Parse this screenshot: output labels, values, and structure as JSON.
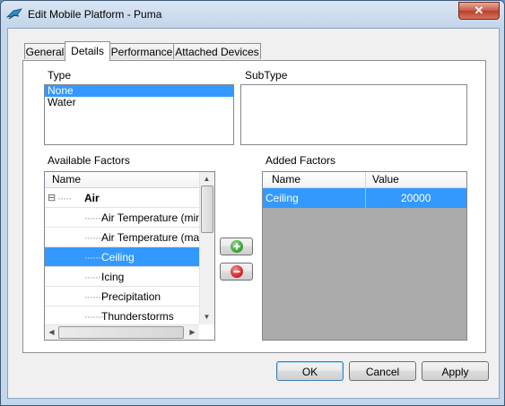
{
  "window": {
    "title": "Edit Mobile Platform - Puma",
    "close_label": "✕"
  },
  "tabs": [
    {
      "label": "General",
      "active": false
    },
    {
      "label": "Details",
      "active": true
    },
    {
      "label": "Performance",
      "active": false
    },
    {
      "label": "Attached Devices",
      "active": false
    }
  ],
  "type": {
    "label": "Type",
    "options": [
      {
        "label": "None",
        "selected": true
      },
      {
        "label": "Water",
        "selected": false
      }
    ]
  },
  "subtype": {
    "label": "SubType",
    "options": []
  },
  "available_factors": {
    "label": "Available Factors",
    "header": "Name",
    "group": {
      "label": "Air",
      "expanded": true,
      "expander": "⊟"
    },
    "rows": [
      {
        "label": "Air Temperature (min)",
        "selected": false
      },
      {
        "label": "Air Temperature (max)",
        "selected": false
      },
      {
        "label": "Ceiling",
        "selected": true
      },
      {
        "label": "Icing",
        "selected": false
      },
      {
        "label": "Precipitation",
        "selected": false
      },
      {
        "label": "Thunderstorms",
        "selected": false
      }
    ]
  },
  "added_factors": {
    "label": "Added Factors",
    "columns": [
      "Name",
      "Value"
    ],
    "rows": [
      {
        "name": "Ceiling",
        "value": "20000",
        "selected": true
      }
    ]
  },
  "buttons": {
    "ok": "OK",
    "cancel": "Cancel",
    "apply": "Apply"
  },
  "colors": {
    "selection": "#3399ff",
    "add_button": "#3fa33b",
    "remove_button": "#d12b2b"
  }
}
